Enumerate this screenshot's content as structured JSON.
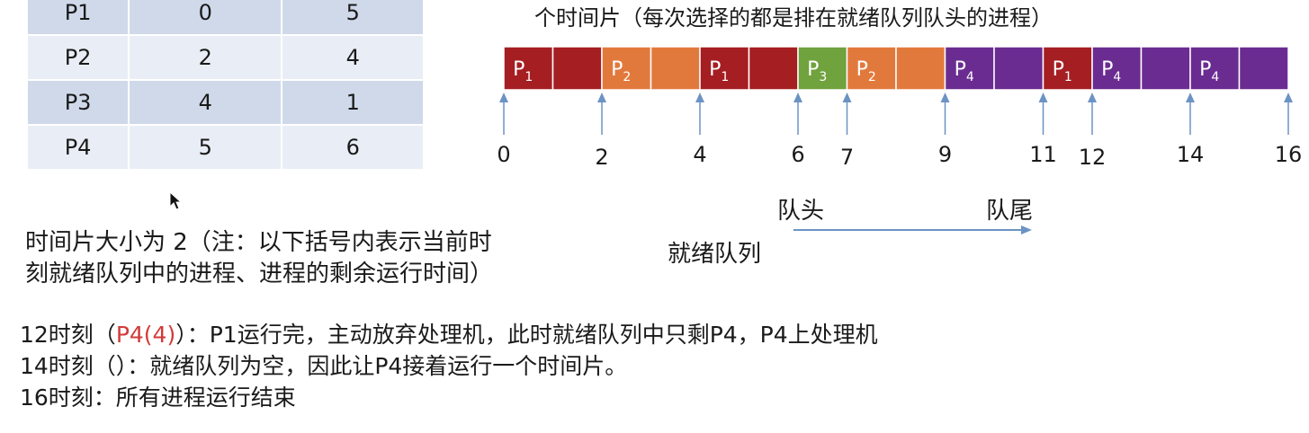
{
  "table": {
    "rows": [
      [
        "P1",
        "0",
        "5"
      ],
      [
        "P2",
        "2",
        "4"
      ],
      [
        "P3",
        "4",
        "1"
      ],
      [
        "P4",
        "5",
        "6"
      ]
    ]
  },
  "top_caption": "个时间片（每次选择的都是排在就绪队列队头的进程）",
  "chart_data": {
    "type": "gantt",
    "time_range": [
      0,
      16
    ],
    "segments": [
      {
        "process": "P1",
        "start": 0,
        "end": 2,
        "sub": "1",
        "color": "#a51e22"
      },
      {
        "process": "P2",
        "start": 2,
        "end": 4,
        "sub": "2",
        "color": "#e2793c"
      },
      {
        "process": "P1",
        "start": 4,
        "end": 6,
        "sub": "1",
        "color": "#a51e22"
      },
      {
        "process": "P3",
        "start": 6,
        "end": 7,
        "sub": "3",
        "color": "#70a23e"
      },
      {
        "process": "P2",
        "start": 7,
        "end": 9,
        "sub": "2",
        "color": "#e2793c"
      },
      {
        "process": "P4",
        "start": 9,
        "end": 11,
        "sub": "4",
        "color": "#6a2c91"
      },
      {
        "process": "P1",
        "start": 11,
        "end": 12,
        "sub": "1",
        "color": "#a51e22"
      },
      {
        "process": "P4",
        "start": 12,
        "end": 14,
        "sub": "4",
        "color": "#6a2c91"
      },
      {
        "process": "P4",
        "start": 14,
        "end": 16,
        "sub": "4",
        "color": "#6a2c91"
      }
    ],
    "ticks": [
      0,
      2,
      4,
      6,
      7,
      9,
      11,
      12,
      14,
      16
    ]
  },
  "queue": {
    "head": "队头",
    "tail": "队尾",
    "label": "就绪队列"
  },
  "note": {
    "line1": "时间片大小为 2（注：以下括号内表示当前时",
    "line2": "刻就绪队列中的进程、进程的剩余运行时间）"
  },
  "events": [
    {
      "pre": "12时刻（",
      "highlight": "P4(4)",
      "post": "）：P1运行完，主动放弃处理机，此时就绪队列中只剩P4，P4上处理机"
    },
    {
      "pre": "14时刻（）：就绪队列为空，因此让P4接着运行一个时间片。",
      "highlight": "",
      "post": ""
    },
    {
      "pre": "16时刻：所有进程运行结束",
      "highlight": "",
      "post": ""
    }
  ],
  "colors": {
    "P1": "#a51e22",
    "P2": "#e2793c",
    "P3": "#70a23e",
    "P4": "#6a2c91",
    "arrow": "#6b93c4",
    "highlight": "#d23a3a"
  }
}
